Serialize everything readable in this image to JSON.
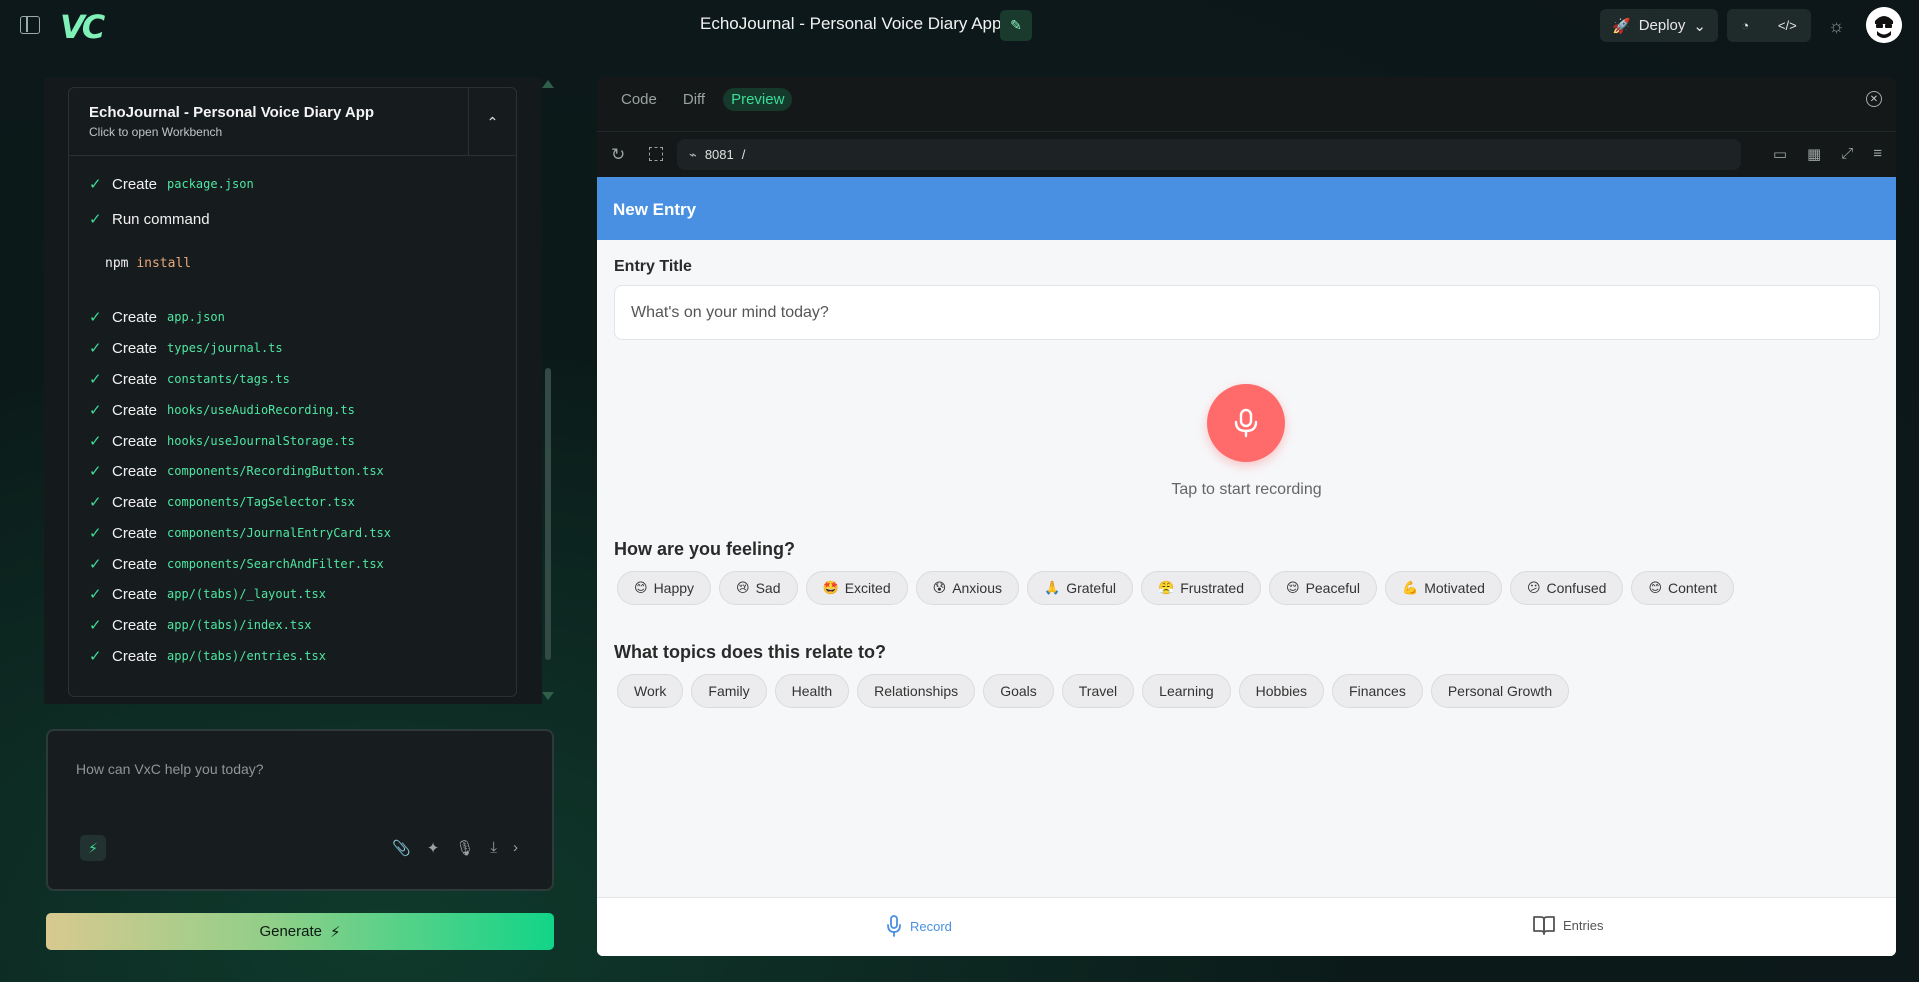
{
  "header": {
    "logo_text": "VC",
    "project_title": "EchoJournal - Personal Voice Diary App",
    "deploy_label": "Deploy"
  },
  "artifact": {
    "title": "EchoJournal - Personal Voice Diary App",
    "subtitle": "Click to open Workbench",
    "steps": [
      {
        "verb": "Create",
        "path": "package.json"
      },
      {
        "verb": "Run command",
        "path": ""
      },
      {
        "verb": "Create",
        "path": "app.json"
      },
      {
        "verb": "Create",
        "path": "types/journal.ts"
      },
      {
        "verb": "Create",
        "path": "constants/tags.ts"
      },
      {
        "verb": "Create",
        "path": "hooks/useAudioRecording.ts"
      },
      {
        "verb": "Create",
        "path": "hooks/useJournalStorage.ts"
      },
      {
        "verb": "Create",
        "path": "components/RecordingButton.tsx"
      },
      {
        "verb": "Create",
        "path": "components/TagSelector.tsx"
      },
      {
        "verb": "Create",
        "path": "components/JournalEntryCard.tsx"
      },
      {
        "verb": "Create",
        "path": "components/SearchAndFilter.tsx"
      },
      {
        "verb": "Create",
        "path": "app/(tabs)/_layout.tsx"
      },
      {
        "verb": "Create",
        "path": "app/(tabs)/index.tsx"
      },
      {
        "verb": "Create",
        "path": "app/(tabs)/entries.tsx"
      }
    ],
    "command": {
      "bin": "npm",
      "arg": "install"
    }
  },
  "prompt": {
    "placeholder": "How can VxC help you today?",
    "generate_label": "Generate"
  },
  "preview": {
    "tabs": [
      "Code",
      "Diff",
      "Preview"
    ],
    "active_tab": "Preview",
    "port": "8081",
    "path": "/"
  },
  "app": {
    "header_title": "New Entry",
    "entry_title_label": "Entry Title",
    "entry_title_placeholder": "What's on your mind today?",
    "record_hint": "Tap to start recording",
    "feeling_title": "How are you feeling?",
    "moods": [
      {
        "emoji": "😊",
        "label": "Happy"
      },
      {
        "emoji": "😢",
        "label": "Sad"
      },
      {
        "emoji": "🤩",
        "label": "Excited"
      },
      {
        "emoji": "😰",
        "label": "Anxious"
      },
      {
        "emoji": "🙏",
        "label": "Grateful"
      },
      {
        "emoji": "😤",
        "label": "Frustrated"
      },
      {
        "emoji": "😌",
        "label": "Peaceful"
      },
      {
        "emoji": "💪",
        "label": "Motivated"
      },
      {
        "emoji": "😕",
        "label": "Confused"
      },
      {
        "emoji": "😊",
        "label": "Content"
      }
    ],
    "topics_title": "What topics does this relate to?",
    "topics": [
      "Work",
      "Family",
      "Health",
      "Relationships",
      "Goals",
      "Travel",
      "Learning",
      "Hobbies",
      "Finances",
      "Personal Growth"
    ],
    "nav": {
      "record": "Record",
      "entries": "Entries"
    }
  },
  "colors": {
    "accent_green": "#3ddc97",
    "header_blue": "#4a90e2",
    "record_red": "#ff6b6b"
  }
}
